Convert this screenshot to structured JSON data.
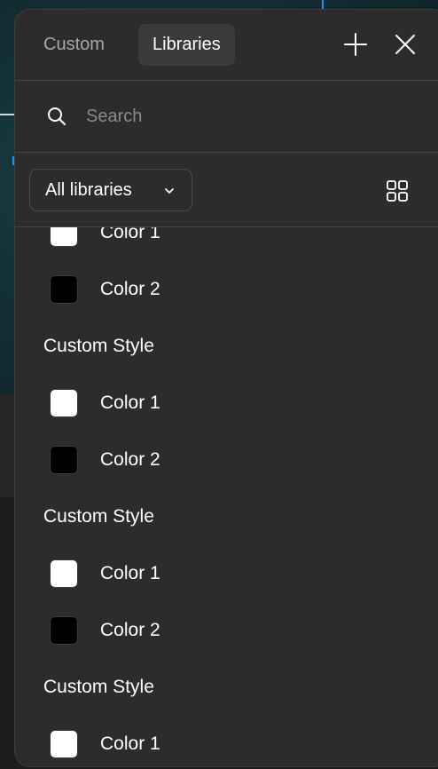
{
  "tabs": [
    {
      "label": "Custom",
      "active": false
    },
    {
      "label": "Libraries",
      "active": true
    }
  ],
  "header": {
    "add_icon": "plus-icon",
    "close_icon": "close-icon"
  },
  "search": {
    "placeholder": "Search",
    "value": "",
    "icon": "search-icon"
  },
  "filter": {
    "selected": "All libraries",
    "view_icon": "grid-view-icon"
  },
  "groups": [
    {
      "items": [
        {
          "label": "Color 1",
          "color": "#ffffff"
        },
        {
          "label": "Color 2",
          "color": "#000000"
        }
      ]
    },
    {
      "title": "Custom Style",
      "items": [
        {
          "label": "Color 1",
          "color": "#ffffff"
        },
        {
          "label": "Color 2",
          "color": "#000000"
        }
      ]
    },
    {
      "title": "Custom Style",
      "items": [
        {
          "label": "Color 1",
          "color": "#ffffff"
        },
        {
          "label": "Color 2",
          "color": "#000000"
        }
      ]
    },
    {
      "title": "Custom Style",
      "items": [
        {
          "label": "Color 1",
          "color": "#ffffff"
        }
      ]
    }
  ],
  "colors": {
    "panel": "#2c2c2c",
    "active_tab": "#3b3b3b",
    "divider": "#444444"
  }
}
